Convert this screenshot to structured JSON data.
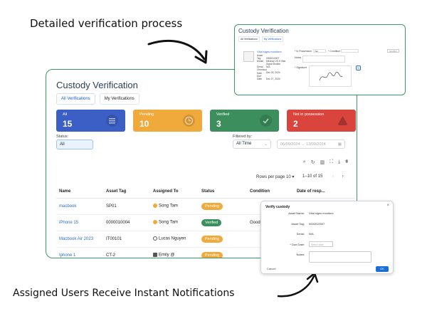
{
  "captions": {
    "top": "Detailed verification process",
    "bottom": "Assigned Users Receive Instant Notifications"
  },
  "main": {
    "title": "Custody Verification",
    "tabs": [
      "All Verifications",
      "My Verifications"
    ],
    "stats": [
      {
        "label": "All",
        "value": "15",
        "color": "#3b5fc4",
        "icon": "list-icon"
      },
      {
        "label": "Pending",
        "value": "10",
        "color": "#f0a93b",
        "icon": "clock-icon"
      },
      {
        "label": "Verified",
        "value": "3",
        "color": "#3c8f5c",
        "icon": "check-icon"
      },
      {
        "label": "Not in possession",
        "value": "2",
        "color": "#d9453c",
        "icon": "warning-icon"
      }
    ],
    "status_label": "Status:",
    "status_value": "All",
    "filter_label": "Filtered by:",
    "filter_value": "All Time",
    "date_start": "06/09/2024",
    "date_end": "13/09/2024",
    "date_sep": "→",
    "rows_per_page_label": "Rows per page",
    "rows_per_page_value": "10",
    "pagination_text": "1–10 of 15",
    "columns": [
      "Name",
      "Asset Tag",
      "Assigned To",
      "Status",
      "Condition",
      "Date of resp..."
    ],
    "rows": [
      {
        "name": "macbook",
        "tag": "SP01",
        "assigned": "Song Tam",
        "status": "Pending",
        "condition": ""
      },
      {
        "name": "iPhone 15",
        "tag": "0000010004",
        "assigned": "Song Tam",
        "status": "Verified",
        "condition": "Good"
      },
      {
        "name": "Macbook Air 2023",
        "tag": "IT00101",
        "assigned": "Lucas Nguyen",
        "status": "Pending",
        "condition": ""
      },
      {
        "name": "Iphone 1",
        "tag": "CT-2",
        "assigned": "Emily @",
        "status": "Pending",
        "condition": ""
      }
    ]
  },
  "detail": {
    "title": "Custody Verification",
    "tabs": [
      "All Verifications",
      "My Verifications"
    ],
    "asset_name": "Vital signs monitors",
    "info": [
      {
        "k": "Asset Tag",
        "v": "0000010007"
      },
      {
        "k": "Model",
        "v": "Mindray VS 8 Vital"
      },
      {
        "k": "",
        "v": "Signs Monitor"
      },
      {
        "k": "Serial",
        "v": "N/A"
      },
      {
        "k": "Checkout Date",
        "v": "Dec 26, 2024"
      },
      {
        "k": "Due Date",
        "v": "Dec 27, 2024"
      }
    ],
    "in_possession_label": "* In Possession",
    "in_possession_value": "Yes",
    "condition_label": "* Condition",
    "notes_label": "Notes",
    "signature_label": "* Signature",
    "confirm_label": "Confirm"
  },
  "modal": {
    "title": "Verify custody",
    "close": "×",
    "asset_name_label": "Asset Name:",
    "asset_name": "Vital signs monitors",
    "asset_tag_label": "Asset Tag:",
    "asset_tag": "0000010007",
    "serial_label": "Serial:",
    "serial": "N/A",
    "due_date_label": "* Due Date:",
    "due_date_placeholder": "Select date",
    "notes_label": "Notes:",
    "cancel": "Cancel",
    "ok": "OK"
  }
}
